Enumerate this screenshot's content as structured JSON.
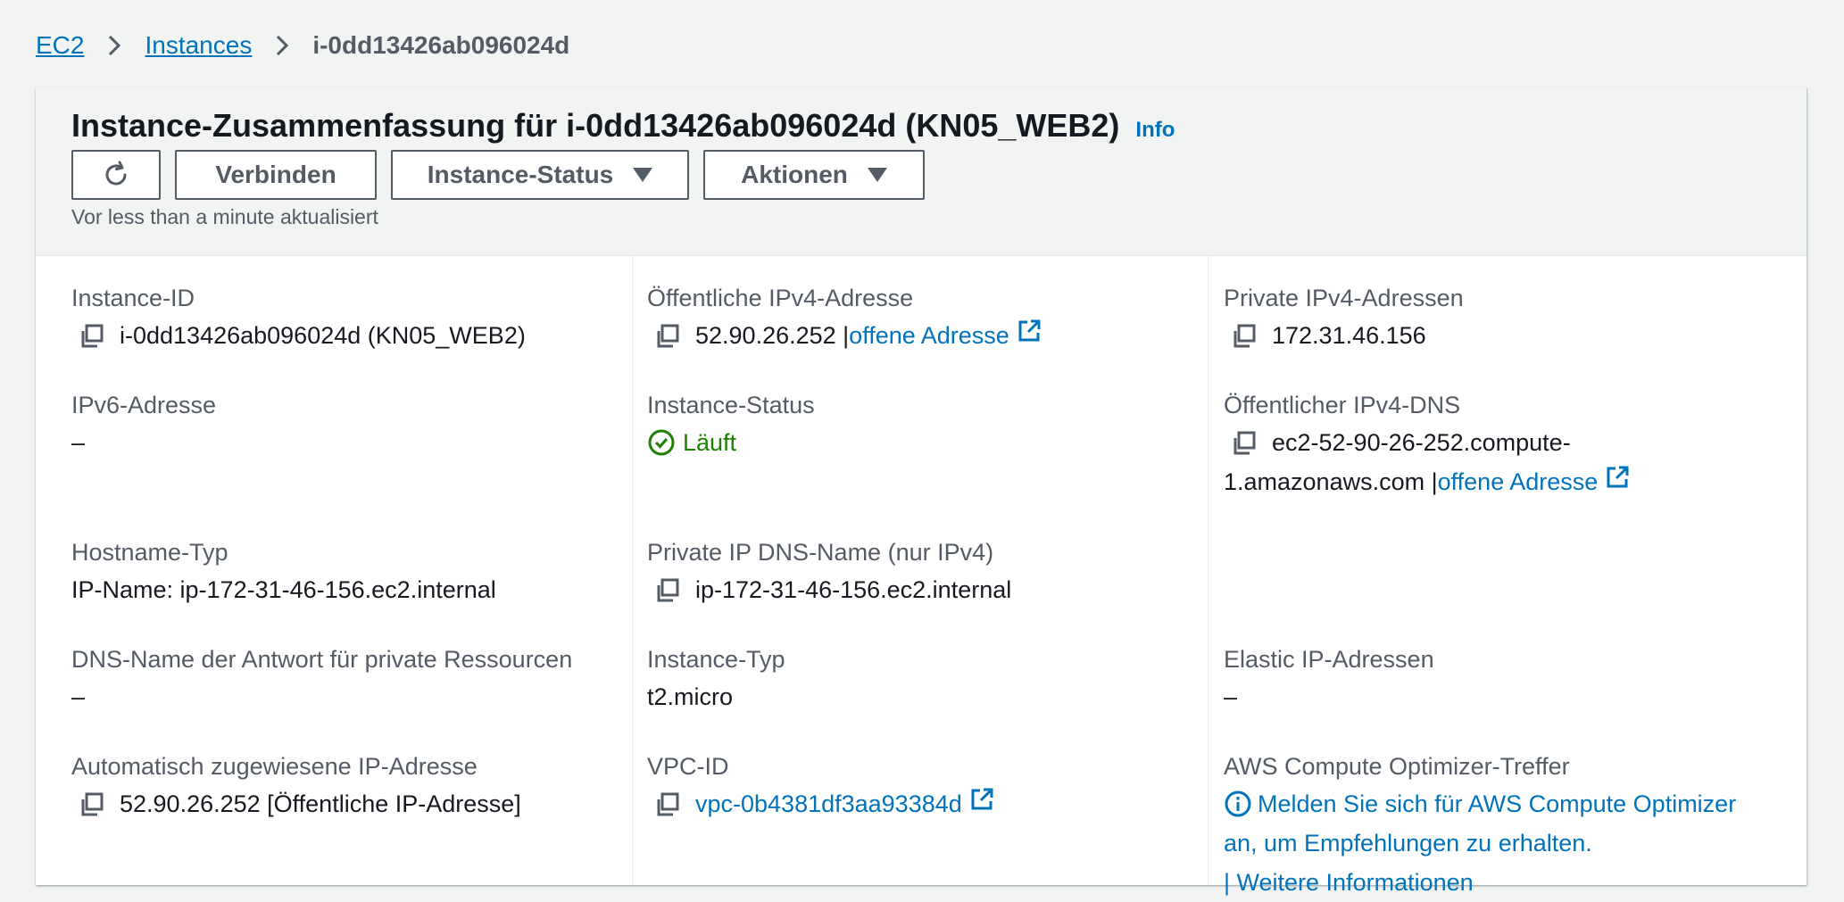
{
  "breadcrumb": {
    "root": "EC2",
    "section": "Instances",
    "current": "i-0dd13426ab096024d"
  },
  "header": {
    "title": "Instance-Zusammenfassung für i-0dd13426ab096024d (KN05_WEB2)",
    "info": "Info",
    "buttons": {
      "connect": "Verbinden",
      "status": "Instance-Status",
      "actions": "Aktionen"
    },
    "updated": "Vor less than a minute aktualisiert"
  },
  "fields": {
    "instance_id": {
      "label": "Instance-ID",
      "value": "i-0dd13426ab096024d (KN05_WEB2)"
    },
    "ipv6": {
      "label": "IPv6-Adresse",
      "value": "–"
    },
    "hostname_type": {
      "label": "Hostname-Typ",
      "value": "IP-Name: ip-172-31-46-156.ec2.internal"
    },
    "dns_private_resource": {
      "label": "DNS-Name der Antwort für private Ressourcen",
      "value": "–"
    },
    "auto_ip": {
      "label": "Automatisch zugewiesene IP-Adresse",
      "value": "52.90.26.252 [Öffentliche IP-Adresse]"
    },
    "public_ipv4": {
      "label": "Öffentliche IPv4-Adresse",
      "value": "52.90.26.252 |",
      "link": "offene Adresse"
    },
    "instance_status": {
      "label": "Instance-Status",
      "value": "Läuft"
    },
    "private_dns": {
      "label": "Private IP DNS-Name (nur IPv4)",
      "value": "ip-172-31-46-156.ec2.internal"
    },
    "instance_type": {
      "label": "Instance-Typ",
      "value": "t2.micro"
    },
    "vpc_id": {
      "label": "VPC-ID",
      "value": "vpc-0b4381df3aa93384d"
    },
    "private_ipv4": {
      "label": "Private IPv4-Adressen",
      "value": "172.31.46.156"
    },
    "public_dns": {
      "label": "Öffentlicher IPv4-DNS",
      "line1": "ec2-52-90-26-252.compute-",
      "line2": "1.amazonaws.com |",
      "link": "offene Adresse"
    },
    "elastic_ip": {
      "label": "Elastic IP-Adressen",
      "value": "–"
    },
    "optimizer": {
      "label": "AWS Compute Optimizer-Treffer",
      "line1": "Melden Sie sich für AWS Compute Optimizer",
      "line2": "an, um Empfehlungen zu erhalten.",
      "line3": "| Weitere Informationen"
    }
  },
  "colors": {
    "link": "#0073bb",
    "success": "#1d8102",
    "text": "#16191f",
    "muted": "#545b64"
  }
}
